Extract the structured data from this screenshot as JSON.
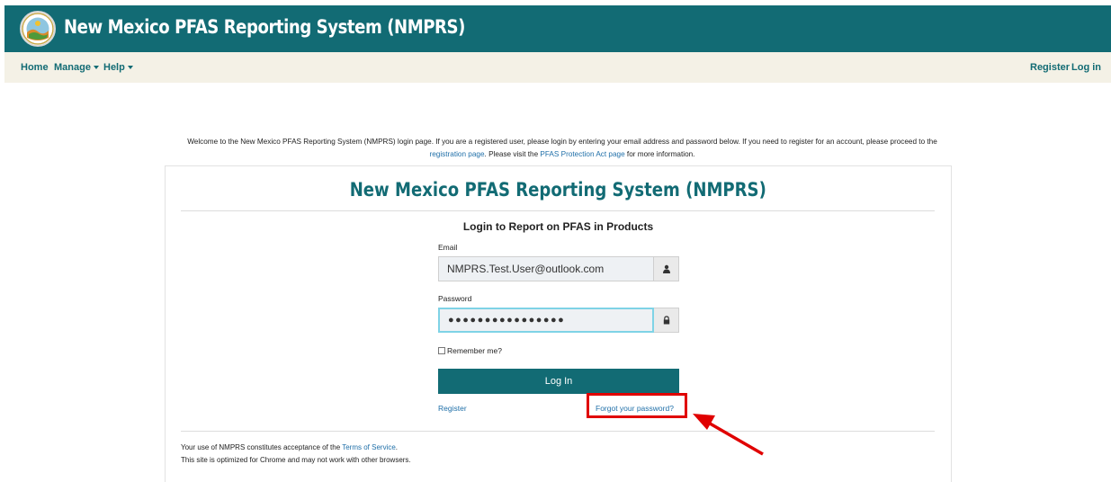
{
  "header": {
    "title": "New Mexico PFAS Reporting System (NMPRS)",
    "logo_icon": "nm-state-seal-icon"
  },
  "nav": {
    "home": "Home",
    "manage": "Manage",
    "help": "Help",
    "register": "Register",
    "login": "Log in"
  },
  "intro": {
    "text_before": "Welcome to the New Mexico PFAS Reporting System (NMPRS) login page. If you are a registered user, please login by entering your email address and password below. If you need to register for an account, please proceed to the ",
    "registration_link": "registration page",
    "text_middle": ". Please visit the ",
    "pfas_link": "PFAS Protection Act page",
    "text_after": " for more information."
  },
  "card": {
    "title": "New Mexico PFAS Reporting System (NMPRS)",
    "subtitle": "Login to Report on PFAS in Products",
    "email_label": "Email",
    "email_value": "NMPRS.Test.User@outlook.com",
    "password_label": "Password",
    "password_value": "●●●●●●●●●●●●●●●●",
    "remember_label": "Remember me?",
    "login_button": "Log In",
    "register_link": "Register",
    "forgot_link": "Forgot your password?"
  },
  "footer": {
    "text_before": "Your use of NMPRS constitutes acceptance of the ",
    "terms_link": "Terms of Service",
    "text_after": ".",
    "browser_note": "This site is optimized for Chrome and may not work with other browsers."
  },
  "colors": {
    "brand": "#126b74",
    "nav_bg": "#f4f1e6",
    "link": "#1f6fa8",
    "annotation": "#e00000"
  }
}
